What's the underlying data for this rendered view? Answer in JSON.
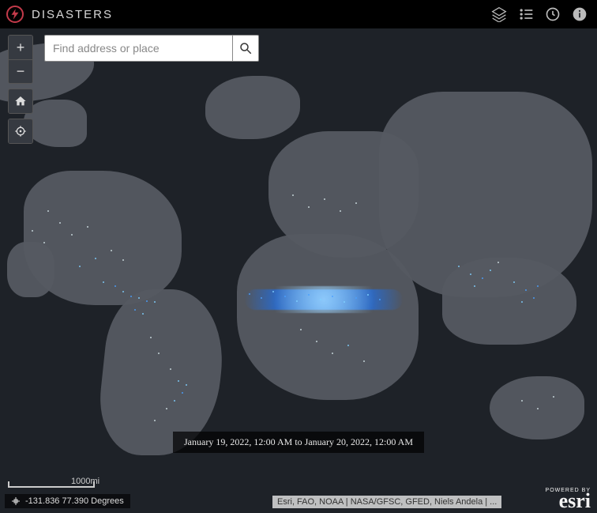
{
  "header": {
    "title": "DISASTERS",
    "tools": {
      "layers": "layers-icon",
      "legend": "legend-icon",
      "time": "clock-icon",
      "info": "info-icon"
    }
  },
  "search": {
    "placeholder": "Find address or place",
    "value": ""
  },
  "controls": {
    "zoom_in": "+",
    "zoom_out": "−",
    "home": "home-icon",
    "locate": "locate-icon"
  },
  "time_range": "January 19, 2022, 12:00 AM to January 20, 2022, 12:00 AM",
  "scale": {
    "label": "1000mi"
  },
  "coords": "-131.836 77.390 Degrees",
  "attribution": "Esri, FAO, NOAA | NASA/GFSC, GFED, Niels Andela | ...",
  "powered_by": {
    "label": "POWERED BY",
    "brand": "esri"
  }
}
